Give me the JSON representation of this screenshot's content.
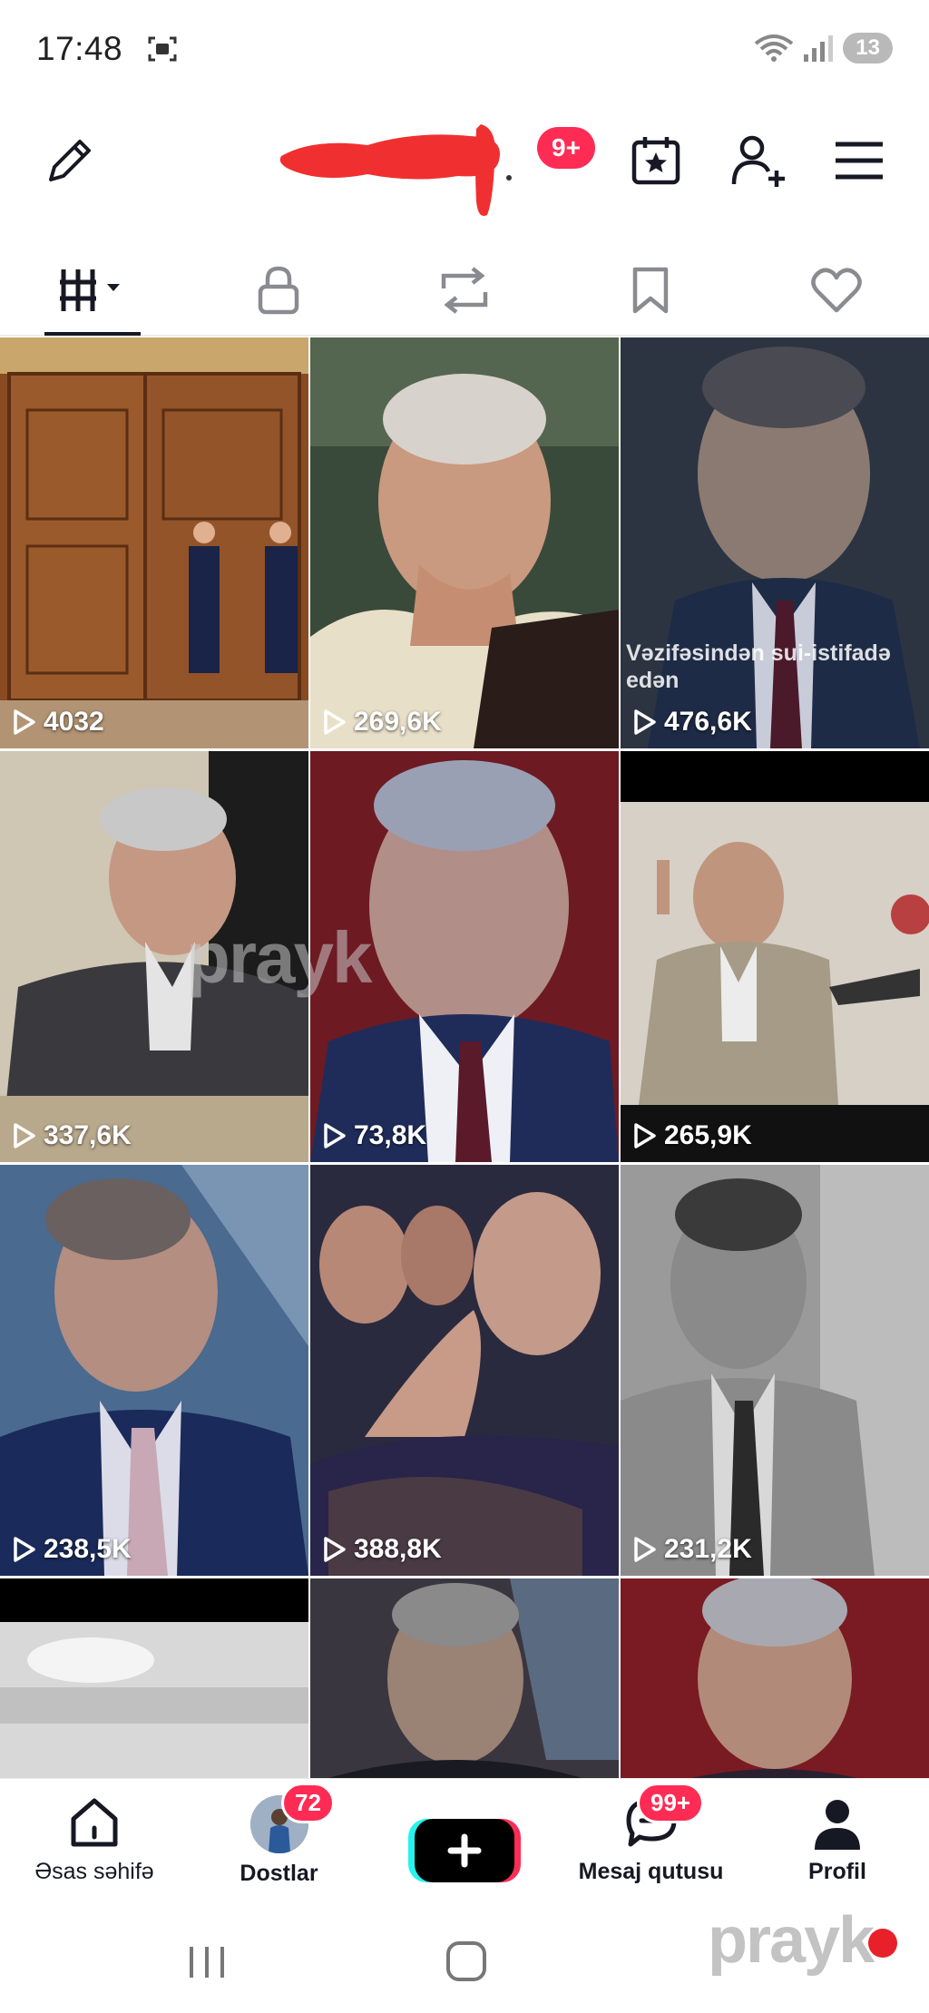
{
  "status_bar": {
    "time": "17:48",
    "battery": "13",
    "icons": [
      "screenshot-icon",
      "wifi-icon",
      "signal-icon",
      "battery-icon"
    ]
  },
  "header": {
    "notification_badge": "9+",
    "icons": [
      "edit-pencil-icon",
      "calendar-star-icon",
      "add-friend-icon",
      "menu-icon"
    ]
  },
  "tabs": [
    {
      "name": "videos",
      "icon": "grid-icon",
      "active": true
    },
    {
      "name": "private",
      "icon": "lock-icon",
      "active": false
    },
    {
      "name": "reposts",
      "icon": "repost-icon",
      "active": false
    },
    {
      "name": "favorites",
      "icon": "bookmark-icon",
      "active": false
    },
    {
      "name": "liked",
      "icon": "heart-icon",
      "active": false
    }
  ],
  "videos": [
    {
      "views": "4032"
    },
    {
      "views": "269,6K"
    },
    {
      "views": "476,6K",
      "overlay_text": "Vəzifəsindən sui-istifadə\nedən"
    },
    {
      "views": "337,6K"
    },
    {
      "views": "73,8K"
    },
    {
      "views": "265,9K"
    },
    {
      "views": "238,5K"
    },
    {
      "views": "388,8K"
    },
    {
      "views": "231,2K"
    },
    {
      "views": ""
    },
    {
      "views": ""
    },
    {
      "views": ""
    }
  ],
  "bottom_nav": {
    "home_label": "Əsas səhifə",
    "friends_label": "Dostlar",
    "friends_badge": "72",
    "inbox_label": "Mesaj qutusu",
    "inbox_badge": "99+",
    "profile_label": "Profil"
  },
  "watermark": "prayk",
  "colors": {
    "accent": "#fe2c55",
    "cyan": "#25f4ee",
    "text": "#161823"
  }
}
